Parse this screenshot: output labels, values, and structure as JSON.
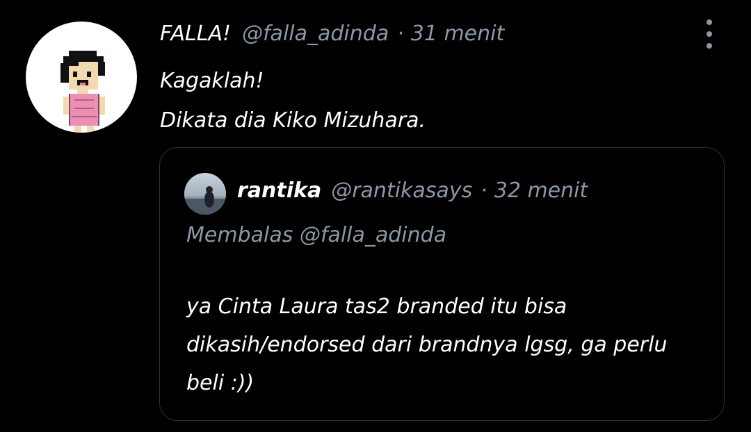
{
  "tweet": {
    "display_name": "FALLA!",
    "handle": "@falla_adinda",
    "separator": "·",
    "time": "31 menit",
    "text_line1": "Kagaklah!",
    "text_line2": "Dikata dia Kiko Mizuhara.",
    "more_icon": "more-vertical-icon"
  },
  "quote": {
    "display_name": "rantika",
    "handle": "@rantikasays",
    "separator": "·",
    "time": "32 menit",
    "reply_label": "Membalas @falla_adinda",
    "text": "ya Cinta Laura tas2 branded itu bisa dikasih/endorsed dari brandnya lgsg, ga perlu beli :))"
  },
  "colors": {
    "background": "#000000",
    "primary_text": "#ffffff",
    "secondary_text": "#8b98a5",
    "border": "#2f3336"
  }
}
